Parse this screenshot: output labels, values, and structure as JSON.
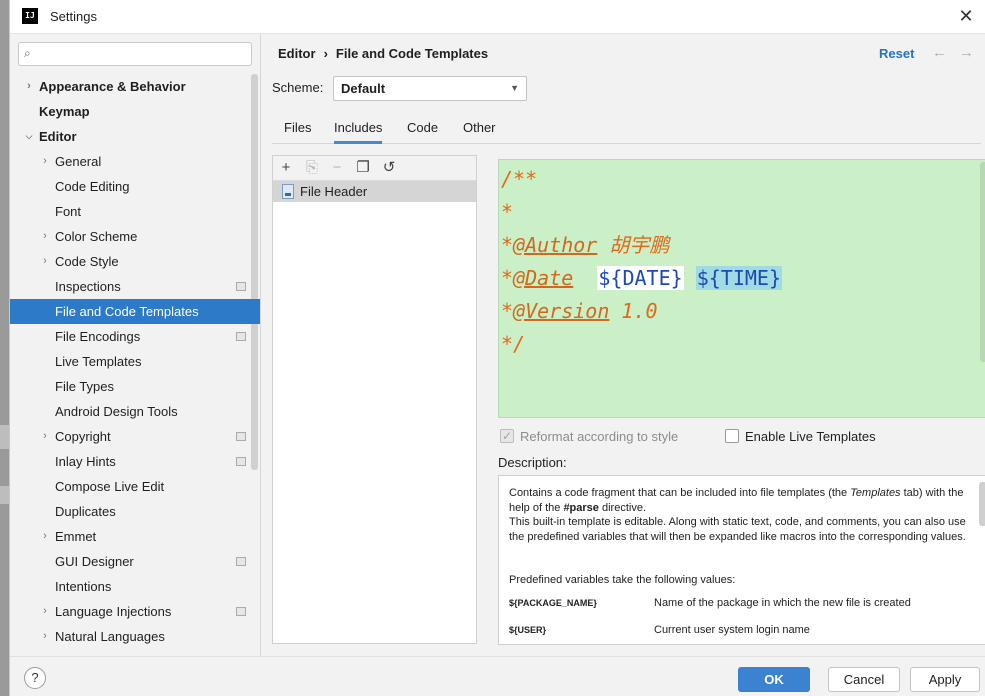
{
  "window": {
    "title": "Settings"
  },
  "search": {
    "placeholder": "",
    "value": ""
  },
  "sidebar": {
    "items": [
      {
        "label": "Appearance & Behavior"
      },
      {
        "label": "Keymap"
      },
      {
        "label": "Editor"
      },
      {
        "label": "General"
      },
      {
        "label": "Code Editing"
      },
      {
        "label": "Font"
      },
      {
        "label": "Color Scheme"
      },
      {
        "label": "Code Style"
      },
      {
        "label": "Inspections"
      },
      {
        "label": "File and Code Templates"
      },
      {
        "label": "File Encodings"
      },
      {
        "label": "Live Templates"
      },
      {
        "label": "File Types"
      },
      {
        "label": "Android Design Tools"
      },
      {
        "label": "Copyright"
      },
      {
        "label": "Inlay Hints"
      },
      {
        "label": "Compose Live Edit"
      },
      {
        "label": "Duplicates"
      },
      {
        "label": "Emmet"
      },
      {
        "label": "GUI Designer"
      },
      {
        "label": "Intentions"
      },
      {
        "label": "Language Injections"
      },
      {
        "label": "Natural Languages"
      }
    ]
  },
  "header": {
    "breadcrumb_parent": "Editor",
    "breadcrumb_current": "File and Code Templates",
    "reset_label": "Reset"
  },
  "scheme": {
    "label": "Scheme:",
    "value": "Default"
  },
  "tabs": [
    {
      "label": "Files"
    },
    {
      "label": "Includes"
    },
    {
      "label": "Code"
    },
    {
      "label": "Other"
    }
  ],
  "list": {
    "items": [
      {
        "label": "File Header"
      }
    ]
  },
  "editor": {
    "line1": "/**",
    "line2": "*",
    "line3_prefix": "*",
    "line3_tag": "@Author",
    "line3_rest": " 胡宇鹏",
    "line4_prefix": "*",
    "line4_tag": "@Date",
    "line4_var1": "${DATE}",
    "line4_var2": "${TIME}",
    "line5_prefix": "*",
    "line5_tag": "@Version",
    "line5_rest": " 1.0",
    "line6": "*/"
  },
  "options": {
    "reformat_label": "Reformat according to style",
    "reformat_checked": true,
    "live_templates_label": "Enable Live Templates",
    "live_templates_checked": false
  },
  "description": {
    "label": "Description:",
    "p1_a": "Contains a code fragment that can be included into file templates (the ",
    "p1_b": "Templates",
    "p1_c": " tab) with the help of the ",
    "p1_d": "#parse",
    "p1_e": " directive.",
    "p2": "This built-in template is editable. Along with static text, code, and comments, you can also use the predefined variables that will then be expanded like macros into the corresponding values.",
    "p3": "Predefined variables take the following values:",
    "vars": [
      {
        "name": "${PACKAGE_NAME}",
        "desc": "Name of the package in which the new file is created"
      },
      {
        "name": "${USER}",
        "desc": "Current user system login name"
      }
    ]
  },
  "footer": {
    "help_label": "?",
    "ok_label": "OK",
    "cancel_label": "Cancel",
    "apply_label": "Apply"
  }
}
